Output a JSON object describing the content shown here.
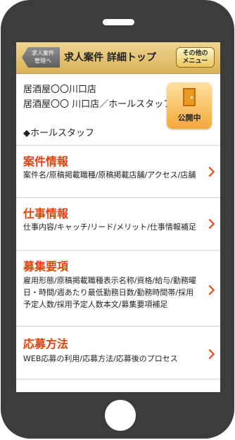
{
  "header": {
    "back_label": [
      "求人案件",
      "管理へ"
    ],
    "title": "求人案件 詳細トップ",
    "menu_label": [
      "その他の",
      "メニュー"
    ]
  },
  "store": {
    "name": "居酒屋〇〇川口店",
    "full_name": "居酒屋〇〇 川口店／ホールスタッフ",
    "job": "◆ホールスタッフ",
    "status": "公開中"
  },
  "sections": [
    {
      "title": "案件情報",
      "desc": "案件名/原稿掲載職種/原稿掲載店舗/アクセス/店舗"
    },
    {
      "title": "仕事情報",
      "desc": "仕事内容/キャッチ/リード/メリット/仕事情報補足"
    },
    {
      "title": "募集要項",
      "desc": "雇用形態/原稿掲載職種表示名称/資格/給与/勤務曜日・時間/週あたり最低勤務日数/勤務時間帯/採用予定人数/採用予定人数本文/募集要項補足"
    },
    {
      "title": "応募方法",
      "desc": "WEB応募の利用/応募方法/応募後のプロセス"
    }
  ],
  "colors": {
    "accent": "#e2410e",
    "header": "#e4c16f",
    "device": "#3c3c3c"
  },
  "icons": {
    "status": "door-icon",
    "section_arrow": "chevron-right-icon"
  }
}
